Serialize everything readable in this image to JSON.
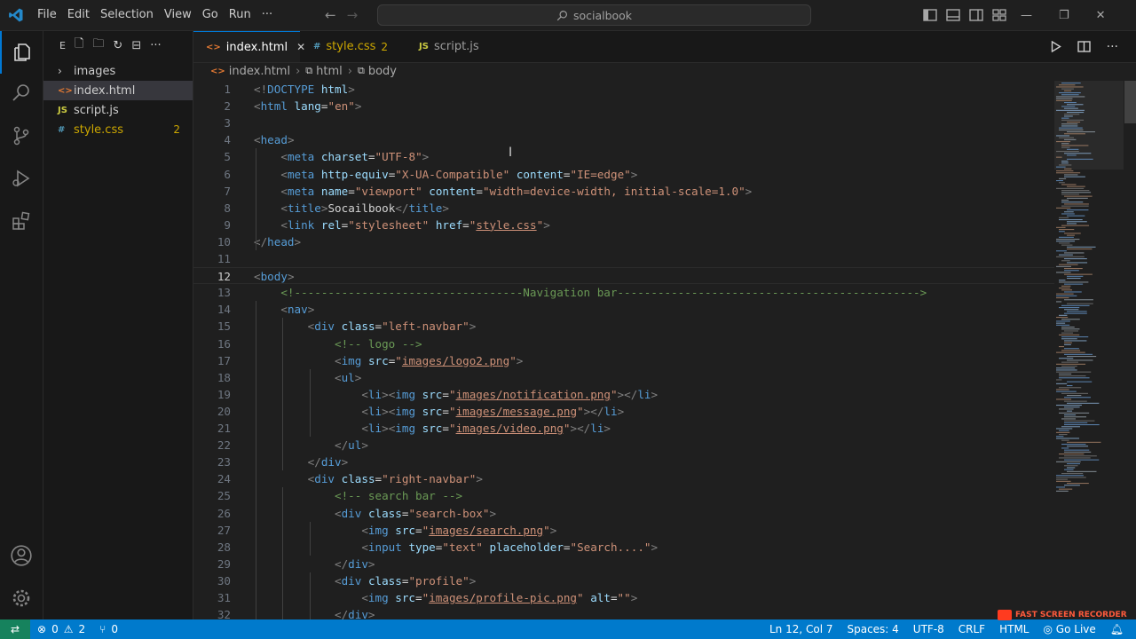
{
  "menu": [
    "File",
    "Edit",
    "Selection",
    "View",
    "Go",
    "Run",
    "···"
  ],
  "search": {
    "text": "socialbook"
  },
  "sidebar": {
    "title": "E",
    "items": [
      {
        "label": "images",
        "icon": "chevron-right-icon",
        "kind": "folder"
      },
      {
        "label": "index.html",
        "icon": "<>",
        "kind": "html",
        "selected": true
      },
      {
        "label": "script.js",
        "icon": "JS",
        "kind": "js"
      },
      {
        "label": "style.css",
        "icon": "#",
        "kind": "css",
        "badge": "2"
      }
    ]
  },
  "tabs": [
    {
      "label": "index.html",
      "icon": "<>",
      "active": true,
      "close": "✕"
    },
    {
      "label": "style.css",
      "icon": "#",
      "badge": "2"
    },
    {
      "label": "script.js",
      "icon": "JS"
    }
  ],
  "breadcrumb": [
    "index.html",
    "html",
    "body"
  ],
  "editor": {
    "current_line": 12,
    "lines": [
      "<!DOCTYPE html>",
      "<html lang=\"en\">",
      "",
      "<head>",
      "    <meta charset=\"UTF-8\">",
      "    <meta http-equiv=\"X-UA-Compatible\" content=\"IE=edge\">",
      "    <meta name=\"viewport\" content=\"width=device-width, initial-scale=1.0\">",
      "    <title>Socailbook</title>",
      "    <link rel=\"stylesheet\" href=\"style.css\">",
      "</head>",
      "",
      "<body>",
      "    <!----------------------------------Navigation bar--------------------------------------------->",
      "    <nav>",
      "        <div class=\"left-navbar\">",
      "            <!-- logo -->",
      "            <img src=\"images/logo2.png\">",
      "            <ul>",
      "                <li><img src=\"images/notification.png\"></li>",
      "                <li><img src=\"images/message.png\"></li>",
      "                <li><img src=\"images/video.png\"></li>",
      "            </ul>",
      "        </div>",
      "        <div class=\"right-navbar\">",
      "            <!-- search bar -->",
      "            <div class=\"search-box\">",
      "                <img src=\"images/search.png\">",
      "                <input type=\"text\" placeholder=\"Search....\">",
      "            </div>",
      "            <div class=\"profile\">",
      "                <img src=\"images/profile-pic.png\" alt=\"\">",
      "            </div>"
    ]
  },
  "status": {
    "errors": "0",
    "warnings": "2",
    "ports": "0",
    "position": "Ln 12, Col 7",
    "spaces": "Spaces: 4",
    "encoding": "UTF-8",
    "eol": "CRLF",
    "language": "HTML",
    "golive": "Go Live"
  },
  "watermark": "FAST SCREEN RECORDER",
  "colors": {
    "accent": "#0078d4",
    "statusbar": "#007acc",
    "html_icon": "#e37933",
    "js_icon": "#cbcb41",
    "css_icon": "#519aba",
    "warning": "#cca700"
  }
}
